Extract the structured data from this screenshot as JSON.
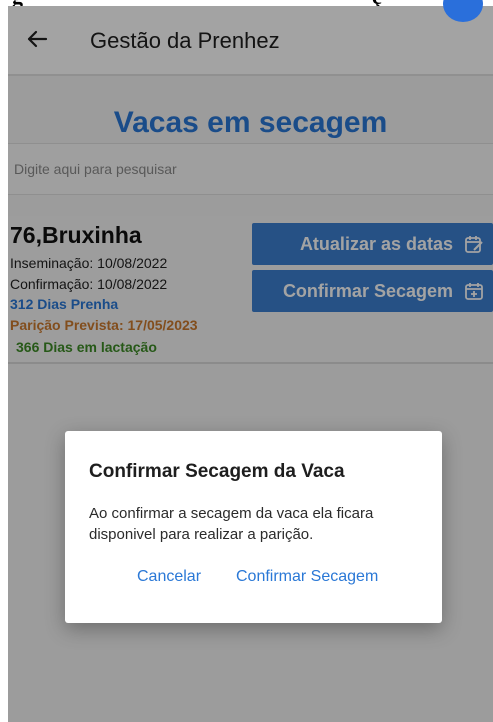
{
  "doc_heading": {
    "lead": "g",
    "tail": "ç"
  },
  "appbar": {
    "title": "Gestão da Prenhez",
    "back_icon": "arrow-left-icon"
  },
  "section_title": "Vacas em secagem",
  "search": {
    "placeholder": "Digite aqui para pesquisar",
    "value": ""
  },
  "card": {
    "name": "76,Bruxinha",
    "insemination": "Inseminação: 10/08/2022",
    "confirmation": "Confirmação: 10/08/2022",
    "pregnant_days": "312 Dias Prenha",
    "expected_calving": "Parição Prevista: 17/05/2023",
    "lactation_days": "366 Dias em lactação",
    "update_button": "Atualizar as datas",
    "update_icon": "calendar-edit-icon",
    "confirm_button": "Confirmar Secagem",
    "confirm_icon": "calendar-plus-icon"
  },
  "dialog": {
    "title": "Confirmar Secagem da Vaca",
    "body": "Ao confirmar a secagem da vaca ela ficara disponivel para realizar a parição.",
    "cancel": "Cancelar",
    "confirm": "Confirmar Secagem"
  },
  "colors": {
    "accent": "#2a78d6",
    "button": "#3c7fd0",
    "calving": "#cc7a2e",
    "lactation": "#3d8b27"
  }
}
